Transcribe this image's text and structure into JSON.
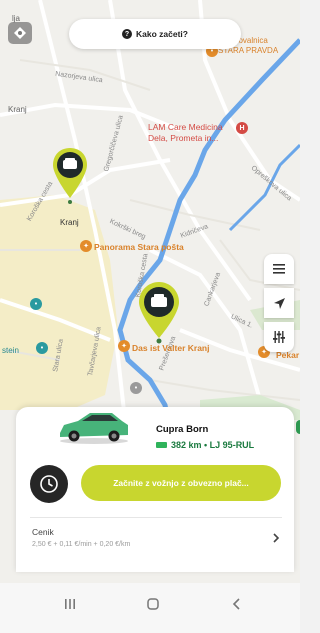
{
  "top_button": {
    "icon": "question-icon",
    "label": "Kako začeti?"
  },
  "map": {
    "street_labels": [
      "Nazorjeva ulica",
      "Gregorčičeva ulica",
      "Koroška cesta",
      "Kokrški breg",
      "Tavčarjeva ulica",
      "Stara ulica",
      "Opreškova ulica",
      "Ulica 1.",
      "Cankarjeva",
      "Koroška cesta",
      "Prešernova",
      "Kidričeva"
    ],
    "labels": {
      "kranj_top": "Kranj",
      "kranj_station": "Kranj",
      "stein": "stein",
      "panorama": "Panorama Stara pošta",
      "das_ist": "Das ist Valter Kranj",
      "pekarna": "Pekar",
      "lam": "LAM Care Medicina Dela, Prometa in...",
      "zavarovalnica": "Zavarovalnica\nSTARA PRAVDA",
      "top_left_letter": "lja"
    },
    "colors": {
      "river": "#6aa6e9",
      "parking": "#f3e8b8",
      "pin_primary": "#c8d62f",
      "pin_dark": "#1f2a2a",
      "pin_green": "#3c7b3f"
    }
  },
  "fabs": [
    {
      "icon": "list-icon"
    },
    {
      "icon": "navigate-icon"
    },
    {
      "icon": "filter-icon"
    }
  ],
  "card": {
    "car_name": "Cupra Born",
    "car_info": "382 km • LJ 95-RUL",
    "start_label": "Začnite z vožnjo z obvezno plač...",
    "cenik_title": "Cenik",
    "cenik_price": "2,50 € + 0,11 €/min + 0,20 €/km"
  },
  "navbar": {
    "icons": [
      "recent-apps-icon",
      "home-icon",
      "back-icon"
    ]
  }
}
